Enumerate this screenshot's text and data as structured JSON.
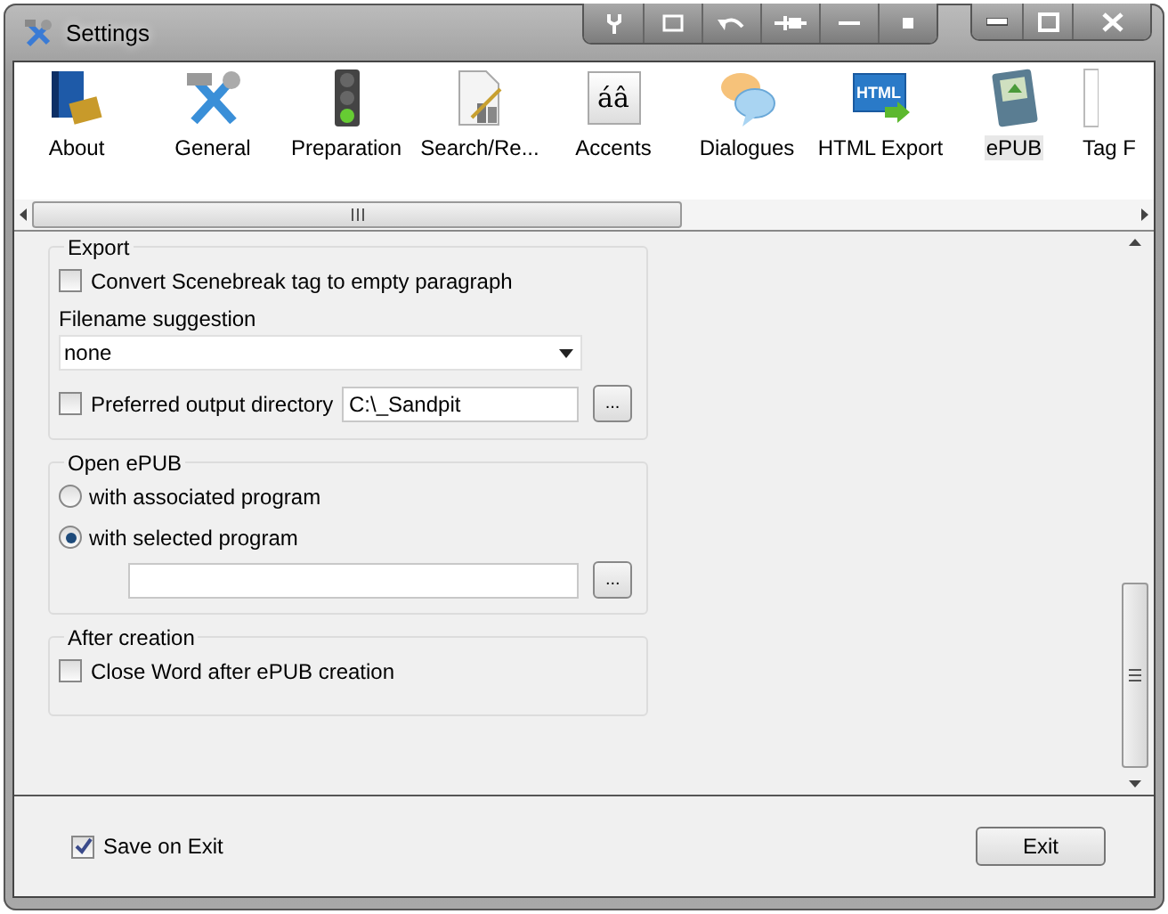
{
  "window": {
    "title": "Settings"
  },
  "tabs": [
    {
      "label": "About",
      "kind": "book",
      "selected": false
    },
    {
      "label": "General",
      "kind": "tools",
      "selected": false
    },
    {
      "label": "Preparation",
      "kind": "light",
      "selected": false
    },
    {
      "label": "Search/Re...",
      "kind": "document",
      "selected": false
    },
    {
      "label": "Accents",
      "kind": "glyph",
      "glyph": "áâ",
      "selected": false
    },
    {
      "label": "Dialogues",
      "kind": "bubbles",
      "selected": false
    },
    {
      "label": "HTML Export",
      "kind": "html",
      "glyph": "HTML",
      "selected": false
    },
    {
      "label": "ePUB",
      "kind": "ebook",
      "selected": true
    },
    {
      "label": "Tag F",
      "kind": "blank",
      "selected": false
    }
  ],
  "export": {
    "title": "Export",
    "convert": {
      "label": "Convert Scenebreak tag to empty paragraph",
      "checked": false
    },
    "filename_label": "Filename suggestion",
    "filename_value": "none",
    "preferred": {
      "label": "Preferred output directory",
      "checked": false,
      "value": "C:\\_Sandpit",
      "browse": "..."
    }
  },
  "open_epub": {
    "title": "Open ePUB",
    "options": [
      {
        "label": "with associated program",
        "selected": false
      },
      {
        "label": "with selected program",
        "selected": true
      }
    ],
    "browse": "..."
  },
  "after_creation": {
    "title": "After creation",
    "close_word": {
      "label": "Close Word after ePUB creation",
      "checked": false
    }
  },
  "footer": {
    "save_on_exit": {
      "label": "Save on Exit",
      "checked": true
    },
    "exit_button": "Exit"
  }
}
